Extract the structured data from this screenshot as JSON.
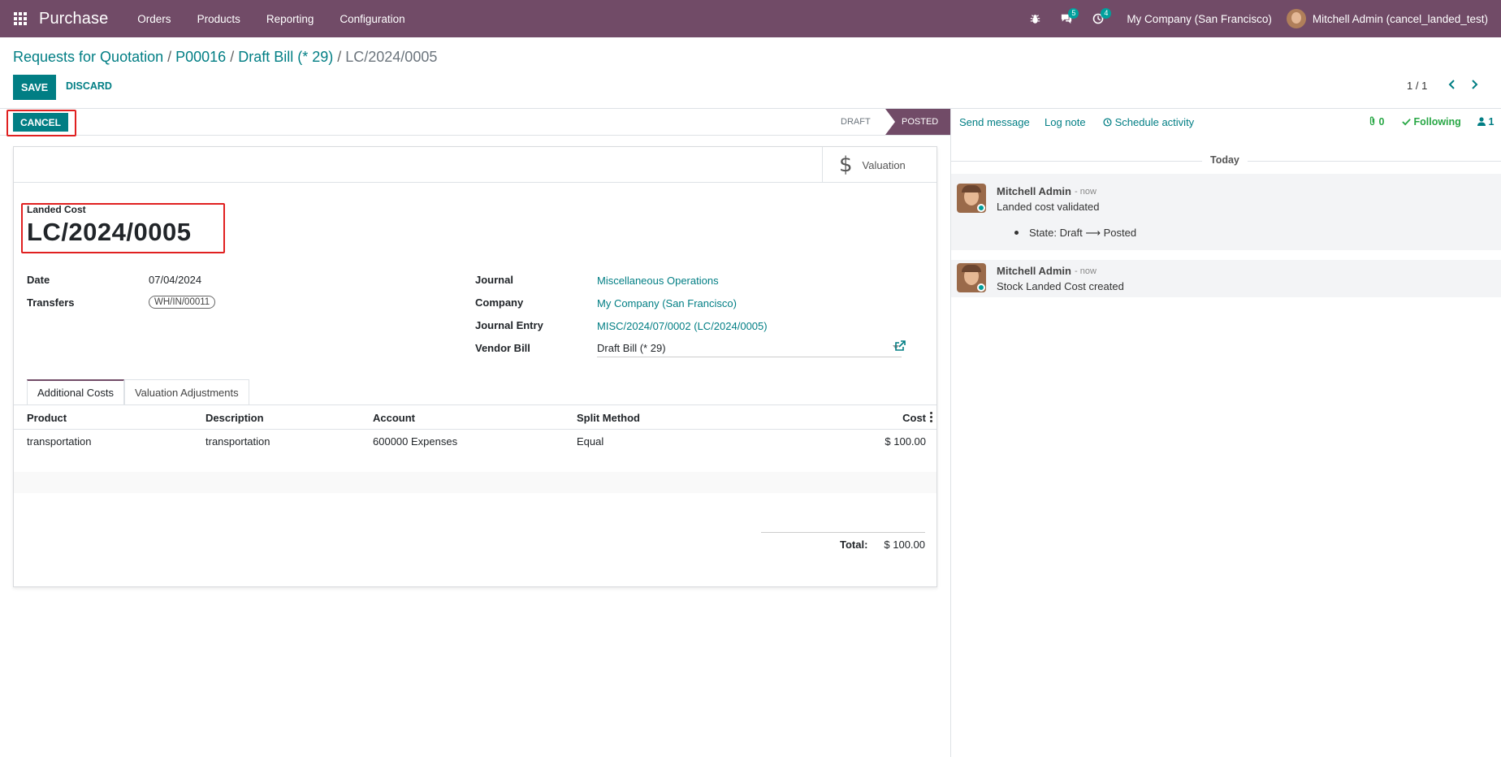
{
  "navbar": {
    "app_name": "Purchase",
    "menu": [
      "Orders",
      "Products",
      "Reporting",
      "Configuration"
    ],
    "messages_badge": "5",
    "activities_badge": "4",
    "company": "My Company (San Francisco)",
    "user": "Mitchell Admin (cancel_landed_test)",
    "icons": [
      "apps-grid-icon",
      "bug-icon",
      "chat-icon",
      "clock-icon"
    ]
  },
  "breadcrumb": {
    "items": [
      "Requests for Quotation",
      "P00016",
      "Draft Bill (* 29)"
    ],
    "current": "LC/2024/0005"
  },
  "control": {
    "save": "SAVE",
    "discard": "DISCARD",
    "pager": "1 / 1"
  },
  "statusbar": {
    "cancel": "CANCEL",
    "stages": [
      "DRAFT",
      "POSTED"
    ],
    "active_stage": "POSTED"
  },
  "form": {
    "smart_button": "Valuation",
    "title_label": "Landed Cost",
    "title": "LC/2024/0005",
    "date_label": "Date",
    "date": "07/04/2024",
    "transfers_label": "Transfers",
    "transfer_tag": "WH/IN/00011",
    "journal_label": "Journal",
    "journal": "Miscellaneous Operations",
    "company_label": "Company",
    "company": "My Company (San Francisco)",
    "journal_entry_label": "Journal Entry",
    "journal_entry": "MISC/2024/07/0002 (LC/2024/0005)",
    "vendor_bill_label": "Vendor Bill",
    "vendor_bill": "Draft Bill (* 29)",
    "tabs": [
      "Additional Costs",
      "Valuation Adjustments"
    ],
    "table": {
      "headers": [
        "Product",
        "Description",
        "Account",
        "Split Method",
        "Cost"
      ],
      "rows": [
        [
          "transportation",
          "transportation",
          "600000 Expenses",
          "Equal",
          "$ 100.00"
        ]
      ]
    },
    "total_label": "Total:",
    "total": "$ 100.00"
  },
  "chatter": {
    "send_message": "Send message",
    "log_note": "Log note",
    "schedule_activity": "Schedule activity",
    "attachments": "0",
    "following": "Following",
    "followers": "1",
    "today": "Today",
    "messages": [
      {
        "author": "Mitchell Admin",
        "time": "- now",
        "body": "Landed cost validated",
        "detail": "State: Draft ⟶ Posted"
      },
      {
        "author": "Mitchell Admin",
        "time": "- now",
        "body": "Stock Landed Cost created"
      }
    ]
  },
  "colors": {
    "brand": "#714b67",
    "accent": "#017e84",
    "highlight": "#e02020",
    "online": "#00a09d"
  }
}
